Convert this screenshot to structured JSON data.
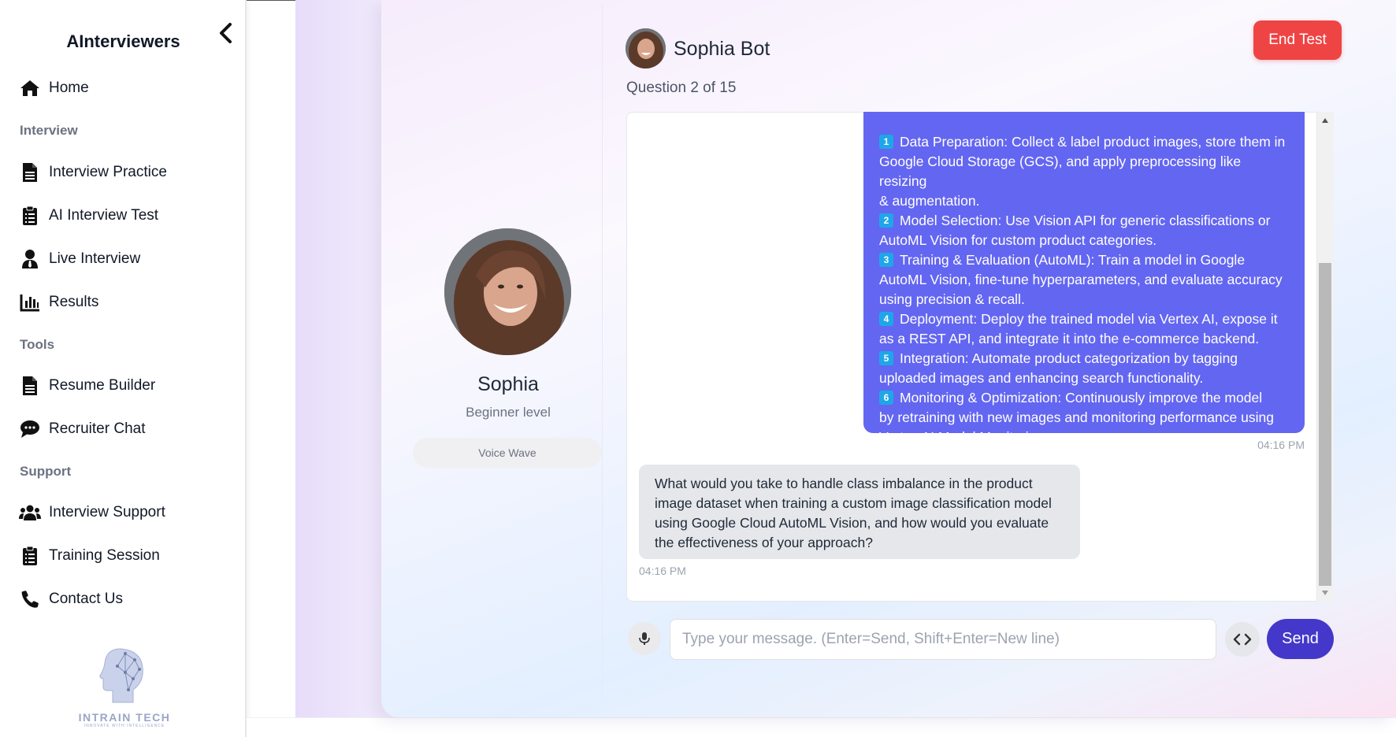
{
  "sidebar": {
    "brand": "AInterviewers",
    "items": [
      {
        "label": "Home",
        "icon": "home-icon"
      },
      {
        "label": "Interview Practice",
        "icon": "document-icon"
      },
      {
        "label": "AI Interview Test",
        "icon": "clipboard-icon"
      },
      {
        "label": "Live Interview",
        "icon": "user-tie-icon"
      },
      {
        "label": "Results",
        "icon": "bar-chart-icon"
      },
      {
        "label": "Resume Builder",
        "icon": "document-icon"
      },
      {
        "label": "Recruiter Chat",
        "icon": "chat-icon"
      },
      {
        "label": "Interview Support",
        "icon": "users-icon"
      },
      {
        "label": "Training Session",
        "icon": "clipboard-icon"
      },
      {
        "label": "Contact Us",
        "icon": "phone-icon"
      }
    ],
    "sections": {
      "interview": "Interview",
      "tools": "Tools",
      "support": "Support"
    },
    "logo": {
      "name": "INTRAIN TECH",
      "tagline": "INNOVATE WITH INTELLIGENCE"
    }
  },
  "profile": {
    "name": "Sophia",
    "level": "Beginner level",
    "voice_wave": "Voice Wave"
  },
  "chat": {
    "bot_name": "Sophia Bot",
    "question_count": "Question 2 of 15",
    "end_label": "End Test",
    "user_message": {
      "lines": [
        {
          "n": "1",
          "text": "Data Preparation: Collect & label product images, store them in"
        },
        {
          "n": "",
          "text": "Google Cloud Storage (GCS), and apply preprocessing like resizing"
        },
        {
          "n": "",
          "text": "& augmentation."
        },
        {
          "n": "2",
          "text": "Model Selection: Use Vision API for generic classifications or"
        },
        {
          "n": "",
          "text": "AutoML Vision for custom product categories."
        },
        {
          "n": "3",
          "text": "Training & Evaluation (AutoML): Train a model in Google"
        },
        {
          "n": "",
          "text": "AutoML Vision, fine-tune hyperparameters, and evaluate accuracy"
        },
        {
          "n": "",
          "text": "using precision & recall."
        },
        {
          "n": "4",
          "text": "Deployment: Deploy the trained model via Vertex AI, expose it"
        },
        {
          "n": "",
          "text": "as a REST API, and integrate it into the e-commerce backend."
        },
        {
          "n": "5",
          "text": "Integration: Automate product categorization by tagging"
        },
        {
          "n": "",
          "text": "uploaded images and enhancing search functionality."
        },
        {
          "n": "6",
          "text": "Monitoring & Optimization: Continuously improve the model"
        },
        {
          "n": "",
          "text": "by retraining with new images and monitoring performance using"
        },
        {
          "n": "",
          "text": "Vertex AI Model Monitoring."
        }
      ],
      "time": "04:16 PM"
    },
    "bot_message": {
      "text": "What would you take to handle class imbalance in the product image dataset when training a custom image classification model using Google Cloud AutoML Vision, and how would you evaluate the effectiveness of your approach?",
      "time": "04:16 PM"
    },
    "input": {
      "placeholder": "Type your message. (Enter=Send, Shift+Enter=New line)",
      "value": ""
    },
    "send_label": "Send"
  },
  "colors": {
    "accent": "#6366f1",
    "send": "#4338ca",
    "danger": "#ef4444",
    "number_badge": "#1ea7e8"
  }
}
